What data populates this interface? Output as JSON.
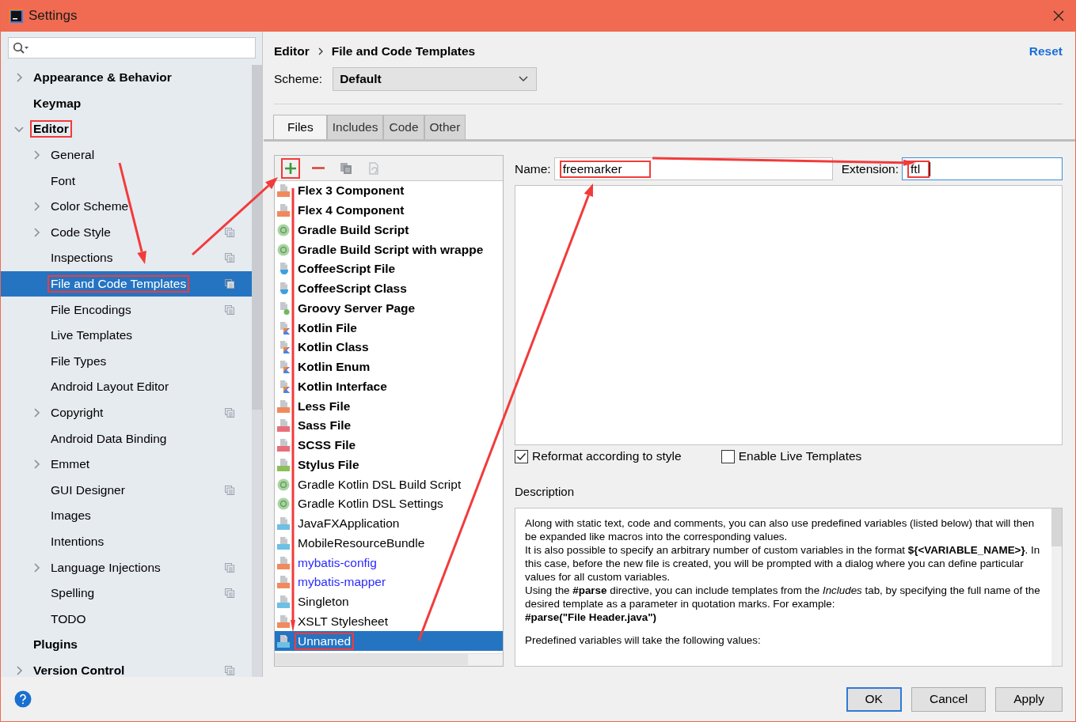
{
  "window": {
    "title": "Settings"
  },
  "sidebar": {
    "items": [
      {
        "label": "Appearance & Behavior",
        "expanded": false,
        "project_scope": false,
        "selected": false,
        "annotated": false
      },
      {
        "label": "Keymap",
        "project_scope": false,
        "selected": false,
        "annotated": false
      },
      {
        "label": "Editor",
        "expanded": true,
        "project_scope": false,
        "selected": false,
        "annotated": true,
        "children": [
          {
            "label": "General",
            "expanded": false,
            "project_scope": false,
            "selected": false,
            "annotated": false
          },
          {
            "label": "Font",
            "project_scope": false,
            "selected": false,
            "annotated": false
          },
          {
            "label": "Color Scheme",
            "expanded": false,
            "project_scope": false,
            "selected": false,
            "annotated": false
          },
          {
            "label": "Code Style",
            "expanded": false,
            "project_scope": true,
            "selected": false,
            "annotated": false
          },
          {
            "label": "Inspections",
            "project_scope": true,
            "selected": false,
            "annotated": false
          },
          {
            "label": "File and Code Templates",
            "project_scope": true,
            "selected": true,
            "annotated": true
          },
          {
            "label": "File Encodings",
            "project_scope": true,
            "selected": false,
            "annotated": false
          },
          {
            "label": "Live Templates",
            "project_scope": false,
            "selected": false,
            "annotated": false
          },
          {
            "label": "File Types",
            "project_scope": false,
            "selected": false,
            "annotated": false
          },
          {
            "label": "Android Layout Editor",
            "project_scope": false,
            "selected": false,
            "annotated": false
          },
          {
            "label": "Copyright",
            "expanded": false,
            "project_scope": true,
            "selected": false,
            "annotated": false
          },
          {
            "label": "Android Data Binding",
            "project_scope": false,
            "selected": false,
            "annotated": false
          },
          {
            "label": "Emmet",
            "expanded": false,
            "project_scope": false,
            "selected": false,
            "annotated": false
          },
          {
            "label": "GUI Designer",
            "project_scope": true,
            "selected": false,
            "annotated": false
          },
          {
            "label": "Images",
            "project_scope": false,
            "selected": false,
            "annotated": false
          },
          {
            "label": "Intentions",
            "project_scope": false,
            "selected": false,
            "annotated": false
          },
          {
            "label": "Language Injections",
            "expanded": false,
            "project_scope": true,
            "selected": false,
            "annotated": false
          },
          {
            "label": "Spelling",
            "project_scope": true,
            "selected": false,
            "annotated": false
          },
          {
            "label": "TODO",
            "project_scope": false,
            "selected": false,
            "annotated": false
          }
        ]
      },
      {
        "label": "Plugins",
        "project_scope": false,
        "selected": false,
        "annotated": false
      },
      {
        "label": "Version Control",
        "expanded": false,
        "project_scope": true,
        "selected": false,
        "annotated": false
      }
    ]
  },
  "breadcrumb": [
    "Editor",
    "File and Code Templates"
  ],
  "reset_link": "Reset",
  "scheme": {
    "label": "Scheme:",
    "value": "Default"
  },
  "tabs": [
    {
      "label": "Files",
      "selected": true
    },
    {
      "label": "Includes",
      "selected": false
    },
    {
      "label": "Code",
      "selected": false
    },
    {
      "label": "Other",
      "selected": false
    }
  ],
  "toolbar": [
    {
      "kind": "add",
      "annotated": true
    },
    {
      "kind": "remove",
      "annotated": false
    },
    {
      "kind": "copy",
      "annotated": false
    },
    {
      "kind": "reset",
      "annotated": false
    }
  ],
  "templates": [
    {
      "label": "Flex 3 Component",
      "kind": "flex",
      "bold": true,
      "color": "#000000",
      "selected": false,
      "annotated": false
    },
    {
      "label": "Flex 4 Component",
      "kind": "flex",
      "bold": true,
      "color": "#000000",
      "selected": false,
      "annotated": false
    },
    {
      "label": "Gradle Build Script",
      "kind": "gradle",
      "bold": true,
      "color": "#000000",
      "selected": false,
      "annotated": false
    },
    {
      "label": "Gradle Build Script with wrappe",
      "kind": "gradle",
      "bold": true,
      "color": "#000000",
      "selected": false,
      "annotated": false
    },
    {
      "label": "CoffeeScript File",
      "kind": "coffee",
      "bold": true,
      "color": "#000000",
      "selected": false,
      "annotated": false
    },
    {
      "label": "CoffeeScript Class",
      "kind": "coffee",
      "bold": true,
      "color": "#000000",
      "selected": false,
      "annotated": false
    },
    {
      "label": "Groovy Server Page",
      "kind": "gsp",
      "bold": true,
      "color": "#000000",
      "selected": false,
      "annotated": false
    },
    {
      "label": "Kotlin File",
      "kind": "kotlin",
      "bold": true,
      "color": "#000000",
      "selected": false,
      "annotated": false
    },
    {
      "label": "Kotlin Class",
      "kind": "kotlin",
      "bold": true,
      "color": "#000000",
      "selected": false,
      "annotated": false
    },
    {
      "label": "Kotlin Enum",
      "kind": "kotlin",
      "bold": true,
      "color": "#000000",
      "selected": false,
      "annotated": false
    },
    {
      "label": "Kotlin Interface",
      "kind": "kotlin",
      "bold": true,
      "color": "#000000",
      "selected": false,
      "annotated": false
    },
    {
      "label": "Less File",
      "kind": "less",
      "bold": true,
      "color": "#000000",
      "selected": false,
      "annotated": false
    },
    {
      "label": "Sass File",
      "kind": "sass",
      "bold": true,
      "color": "#000000",
      "selected": false,
      "annotated": false
    },
    {
      "label": "SCSS File",
      "kind": "sass",
      "bold": true,
      "color": "#000000",
      "selected": false,
      "annotated": false
    },
    {
      "label": "Stylus File",
      "kind": "stylus",
      "bold": true,
      "color": "#000000",
      "selected": false,
      "annotated": false
    },
    {
      "label": "Gradle Kotlin DSL Build Script",
      "kind": "gradle",
      "bold": false,
      "color": "#000000",
      "selected": false,
      "annotated": false
    },
    {
      "label": "Gradle Kotlin DSL Settings",
      "kind": "gradle",
      "bold": false,
      "color": "#000000",
      "selected": false,
      "annotated": false
    },
    {
      "label": "JavaFXApplication",
      "kind": "java",
      "bold": false,
      "color": "#000000",
      "selected": false,
      "annotated": false
    },
    {
      "label": "MobileResourceBundle",
      "kind": "java",
      "bold": false,
      "color": "#000000",
      "selected": false,
      "annotated": false
    },
    {
      "label": "mybatis-config",
      "kind": "xml",
      "bold": false,
      "color": "#2b2bff",
      "selected": false,
      "annotated": false
    },
    {
      "label": "mybatis-mapper",
      "kind": "xml",
      "bold": false,
      "color": "#2b2bff",
      "selected": false,
      "annotated": false
    },
    {
      "label": "Singleton",
      "kind": "java",
      "bold": false,
      "color": "#000000",
      "selected": false,
      "annotated": false
    },
    {
      "label": "XSLT Stylesheet",
      "kind": "xml",
      "bold": false,
      "color": "#000000",
      "selected": false,
      "annotated": false
    },
    {
      "label": "Unnamed",
      "kind": "java",
      "bold": false,
      "selected": true,
      "annotated": true
    }
  ],
  "form": {
    "name_label": "Name:",
    "name_value": "freemarker",
    "name_annotated": true,
    "extension_label": "Extension:",
    "extension_value": "ftl",
    "extension_annotated": true
  },
  "checkboxes": [
    {
      "label": "Reformat according to style",
      "checked": true
    },
    {
      "label": "Enable Live Templates",
      "checked": false
    }
  ],
  "description": {
    "label": "Description",
    "paragraphs": [
      {
        "kind": "text",
        "text": "Along with static text, code and comments, you can also use predefined variables (listed below) that will then be expanded like macros into the corresponding values."
      },
      {
        "kind": "text",
        "text": "It is also possible to specify an arbitrary number of custom variables in the format **${<VARIABLE_NAME>}**. In this case, before the new file is created, you will be prompted with a dialog where you can define particular values for all custom variables."
      },
      {
        "kind": "text",
        "text": "Using the **#parse** directive, you can include templates from the *Includes* tab, by specifying the full name of the desired template as a parameter in quotation marks. For example:"
      },
      {
        "kind": "code",
        "text": "#parse(\"File Header.java\")"
      },
      {
        "kind": "note",
        "text": "Predefined variables will take the following values:"
      }
    ]
  },
  "buttons": [
    {
      "label": "OK",
      "default": true
    },
    {
      "label": "Cancel",
      "default": false
    },
    {
      "label": "Apply",
      "default": false
    }
  ]
}
